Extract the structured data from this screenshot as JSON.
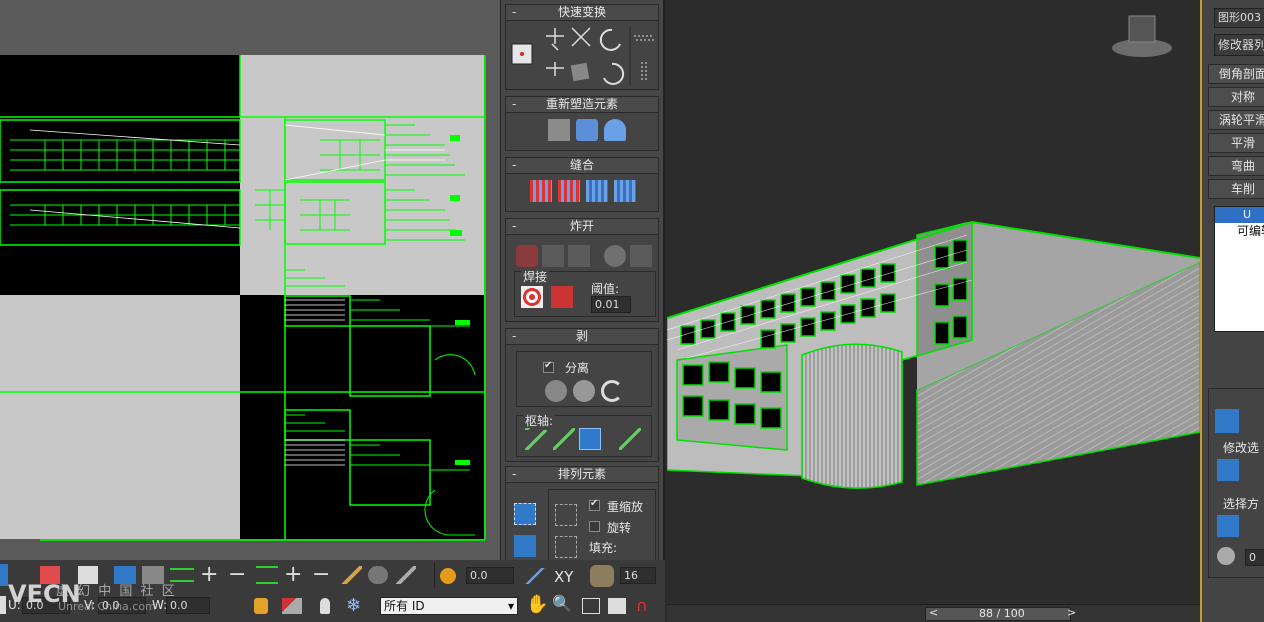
{
  "panel": {
    "transform": {
      "title": "快速变换"
    },
    "reshape": {
      "title": "重新塑造元素"
    },
    "stitch": {
      "title": "缝合"
    },
    "explode": {
      "title": "炸开",
      "weld_label": "焊接",
      "threshold_label": "阈值:",
      "threshold_value": "0.01"
    },
    "peel": {
      "title": "剥",
      "detach_label": "分离",
      "pivot_label": "枢轴:"
    },
    "arrange": {
      "title": "排列元素",
      "rescale_label": "重缩放",
      "rotate_label": "旋转",
      "padding_label": "填充:"
    }
  },
  "bottom": {
    "value1": "0.0",
    "xy_label": "XY",
    "spin_value": "16",
    "id_select": "所有 ID",
    "coord_u": "0.0",
    "coord_v": "0.0",
    "coord_w": "0.0",
    "u_label": "U:",
    "v_label": "V:",
    "w_label": "W:",
    "watermark": "虚 幻 中 国 社 区",
    "watermark_url": "Unreal China.com",
    "logo": "VECN"
  },
  "viewport": {
    "progress_text": "88 / 100",
    "progress_value": 88,
    "prev": "<",
    "next": ">"
  },
  "command": {
    "object_name": "图形003",
    "modifier_list": "修改器列",
    "buttons": [
      "倒角剖面",
      "对称",
      "涡轮平滑",
      "平滑",
      "弯曲",
      "车削"
    ],
    "stack": [
      "U",
      "可编辑"
    ],
    "select_label": "修改选",
    "select_method": "选择方",
    "field_value": "0"
  },
  "colors": {
    "uv_green": "#00e000",
    "selection": "#c79b27",
    "accent": "#2f79c8"
  }
}
